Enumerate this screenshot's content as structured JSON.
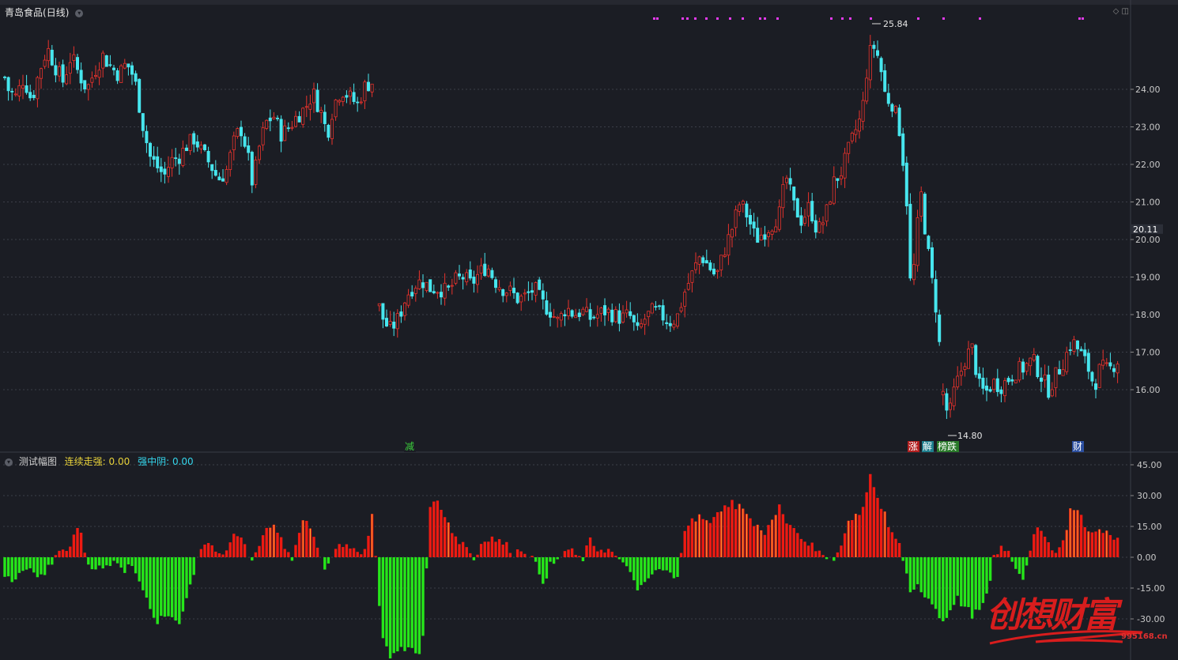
{
  "header": {
    "stock_name": "青岛食品",
    "period": "(日线)"
  },
  "indicator": {
    "name": "测试幅图",
    "field1_label": "连续走强:",
    "field1_value": "0.00",
    "field2_label": "强中阴:",
    "field2_value": "0.00"
  },
  "watermark": {
    "text": "创想财富",
    "url": "995168.cn"
  },
  "colors": {
    "up": "#e8322c",
    "down": "#47e6ee",
    "bar_up": "#ee1a12",
    "bar_down": "#26e61a",
    "magenta": "#e43bee"
  },
  "chart_data": [
    {
      "type": "candlestick",
      "title": "青岛食品(日线)",
      "y_ticks": [
        "24.00",
        "23.00",
        "22.00",
        "21.00",
        "20.00",
        "19.00",
        "18.00",
        "17.00",
        "16.00"
      ],
      "ylim": [
        14.3,
        26.5
      ],
      "last_price": "20.11",
      "annotations": {
        "high": "25.84",
        "low": "14.80",
        "events": [
          "减",
          "涨",
          "解",
          "榜跌",
          "财"
        ]
      },
      "close_path": [
        [
          0,
          24.8
        ],
        [
          10,
          24.0
        ],
        [
          20,
          23.8
        ],
        [
          30,
          24.3
        ],
        [
          40,
          23.7
        ],
        [
          50,
          24.5
        ],
        [
          60,
          25.1
        ],
        [
          70,
          24.6
        ],
        [
          80,
          24.2
        ],
        [
          90,
          24.9
        ],
        [
          100,
          24.4
        ],
        [
          110,
          24.0
        ],
        [
          120,
          24.5
        ],
        [
          130,
          24.9
        ],
        [
          140,
          24.6
        ],
        [
          150,
          24.4
        ],
        [
          160,
          24.7
        ],
        [
          170,
          24.3
        ],
        [
          176,
          23.6
        ],
        [
          182,
          22.9
        ],
        [
          190,
          22.2
        ],
        [
          200,
          21.9
        ],
        [
          208,
          21.7
        ],
        [
          216,
          22.1
        ],
        [
          226,
          22.2
        ],
        [
          236,
          22.5
        ],
        [
          246,
          22.7
        ],
        [
          256,
          22.3
        ],
        [
          266,
          22.0
        ],
        [
          276,
          21.6
        ],
        [
          286,
          21.8
        ],
        [
          296,
          22.6
        ],
        [
          304,
          23.0
        ],
        [
          312,
          22.4
        ],
        [
          320,
          21.4
        ],
        [
          326,
          22.3
        ],
        [
          336,
          23.1
        ],
        [
          346,
          23.3
        ],
        [
          356,
          22.8
        ],
        [
          366,
          23.0
        ],
        [
          376,
          23.3
        ],
        [
          386,
          23.5
        ],
        [
          396,
          23.9
        ],
        [
          406,
          23.4
        ],
        [
          414,
          22.8
        ],
        [
          422,
          23.6
        ],
        [
          432,
          24.0
        ],
        [
          442,
          23.8
        ],
        [
          452,
          23.6
        ],
        [
          462,
          24.1
        ],
        [
          472,
          24.2
        ],
        [
          478,
          18.3
        ],
        [
          486,
          17.8
        ],
        [
          494,
          17.6
        ],
        [
          504,
          17.9
        ],
        [
          514,
          18.5
        ],
        [
          524,
          18.8
        ],
        [
          534,
          18.9
        ],
        [
          544,
          18.7
        ],
        [
          556,
          18.7
        ],
        [
          566,
          18.6
        ],
        [
          576,
          18.9
        ],
        [
          586,
          19.0
        ],
        [
          596,
          18.8
        ],
        [
          606,
          19.1
        ],
        [
          616,
          19.3
        ],
        [
          626,
          18.9
        ],
        [
          636,
          18.7
        ],
        [
          646,
          18.6
        ],
        [
          656,
          18.4
        ],
        [
          666,
          18.5
        ],
        [
          676,
          18.7
        ],
        [
          686,
          18.3
        ],
        [
          696,
          18.1
        ],
        [
          706,
          17.8
        ],
        [
          716,
          18.2
        ],
        [
          726,
          18.0
        ],
        [
          736,
          18.1
        ],
        [
          746,
          17.9
        ],
        [
          756,
          18.0
        ],
        [
          766,
          18.1
        ],
        [
          776,
          18.0
        ],
        [
          786,
          17.9
        ],
        [
          796,
          18.0
        ],
        [
          806,
          17.5
        ],
        [
          816,
          17.9
        ],
        [
          826,
          18.1
        ],
        [
          836,
          18.0
        ],
        [
          846,
          17.8
        ],
        [
          856,
          17.9
        ],
        [
          866,
          18.6
        ],
        [
          876,
          19.1
        ],
        [
          886,
          19.6
        ],
        [
          896,
          19.3
        ],
        [
          906,
          19.0
        ],
        [
          916,
          19.7
        ],
        [
          926,
          20.3
        ],
        [
          936,
          21.0
        ],
        [
          946,
          20.6
        ],
        [
          956,
          20.0
        ],
        [
          966,
          20.2
        ],
        [
          976,
          20.4
        ],
        [
          986,
          20.7
        ],
        [
          994,
          21.7
        ],
        [
          1004,
          20.9
        ],
        [
          1014,
          20.5
        ],
        [
          1024,
          20.9
        ],
        [
          1034,
          20.2
        ],
        [
          1044,
          20.6
        ],
        [
          1054,
          21.5
        ],
        [
          1064,
          21.8
        ],
        [
          1072,
          22.3
        ],
        [
          1082,
          22.9
        ],
        [
          1090,
          23.3
        ],
        [
          1098,
          24.8
        ],
        [
          1104,
          25.2
        ],
        [
          1112,
          24.8
        ],
        [
          1120,
          23.8
        ],
        [
          1130,
          23.6
        ],
        [
          1138,
          22.9
        ],
        [
          1146,
          21.4
        ],
        [
          1152,
          18.6
        ],
        [
          1158,
          19.6
        ],
        [
          1164,
          21.4
        ],
        [
          1170,
          20.3
        ],
        [
          1178,
          19.0
        ],
        [
          1186,
          17.9
        ],
        [
          1192,
          16.0
        ],
        [
          1200,
          15.2
        ],
        [
          1206,
          15.9
        ],
        [
          1214,
          16.4
        ],
        [
          1222,
          16.9
        ],
        [
          1230,
          17.1
        ],
        [
          1238,
          16.1
        ],
        [
          1246,
          15.9
        ],
        [
          1256,
          16.2
        ],
        [
          1266,
          16.1
        ],
        [
          1276,
          16.3
        ],
        [
          1286,
          16.5
        ],
        [
          1296,
          16.6
        ],
        [
          1306,
          16.8
        ],
        [
          1316,
          16.4
        ],
        [
          1326,
          16.0
        ],
        [
          1336,
          16.4
        ],
        [
          1346,
          16.8
        ],
        [
          1356,
          17.3
        ],
        [
          1366,
          17.0
        ],
        [
          1376,
          16.6
        ],
        [
          1384,
          16.1
        ],
        [
          1392,
          16.6
        ],
        [
          1402,
          16.5
        ],
        [
          1414,
          16.8
        ]
      ]
    },
    {
      "type": "bar",
      "title": "测试幅图",
      "y_ticks": [
        "45.00",
        "30.00",
        "15.00",
        "0.00",
        "-15.00",
        "-30.00"
      ],
      "ylim": [
        -50,
        45
      ],
      "value_path": [
        [
          0,
          -8
        ],
        [
          10,
          -10
        ],
        [
          16,
          -12
        ],
        [
          26,
          -6
        ],
        [
          36,
          -4
        ],
        [
          46,
          -10
        ],
        [
          56,
          -8
        ],
        [
          66,
          -2
        ],
        [
          72,
          3
        ],
        [
          80,
          4
        ],
        [
          88,
          3
        ],
        [
          96,
          12
        ],
        [
          102,
          15
        ],
        [
          108,
          -2
        ],
        [
          118,
          -6
        ],
        [
          128,
          -4
        ],
        [
          138,
          -3
        ],
        [
          148,
          -2
        ],
        [
          158,
          -8
        ],
        [
          166,
          -2
        ],
        [
          176,
          -10
        ],
        [
          186,
          -22
        ],
        [
          196,
          -32
        ],
        [
          206,
          -30
        ],
        [
          216,
          -28
        ],
        [
          226,
          -32
        ],
        [
          236,
          -20
        ],
        [
          246,
          -6
        ],
        [
          252,
          4
        ],
        [
          262,
          8
        ],
        [
          272,
          4
        ],
        [
          280,
          -2
        ],
        [
          290,
          6
        ],
        [
          298,
          12
        ],
        [
          308,
          8
        ],
        [
          318,
          -2
        ],
        [
          328,
          6
        ],
        [
          338,
          16
        ],
        [
          348,
          14
        ],
        [
          358,
          6
        ],
        [
          368,
          -2
        ],
        [
          378,
          10
        ],
        [
          386,
          20
        ],
        [
          394,
          12
        ],
        [
          402,
          6
        ],
        [
          410,
          -6
        ],
        [
          420,
          2
        ],
        [
          430,
          8
        ],
        [
          440,
          4
        ],
        [
          450,
          2
        ],
        [
          460,
          4
        ],
        [
          466,
          10
        ],
        [
          472,
          24
        ],
        [
          478,
          -20
        ],
        [
          486,
          -42
        ],
        [
          494,
          -48
        ],
        [
          504,
          -46
        ],
        [
          514,
          -44
        ],
        [
          524,
          -45
        ],
        [
          534,
          -46
        ],
        [
          544,
          24
        ],
        [
          554,
          28
        ],
        [
          562,
          22
        ],
        [
          570,
          14
        ],
        [
          580,
          8
        ],
        [
          590,
          6
        ],
        [
          600,
          -2
        ],
        [
          610,
          8
        ],
        [
          620,
          10
        ],
        [
          630,
          8
        ],
        [
          640,
          6
        ],
        [
          650,
          2
        ],
        [
          660,
          4
        ],
        [
          670,
          2
        ],
        [
          680,
          -6
        ],
        [
          688,
          -12
        ],
        [
          696,
          -4
        ],
        [
          706,
          -2
        ],
        [
          716,
          4
        ],
        [
          726,
          2
        ],
        [
          736,
          -2
        ],
        [
          746,
          8
        ],
        [
          756,
          4
        ],
        [
          766,
          4
        ],
        [
          776,
          2
        ],
        [
          786,
          -4
        ],
        [
          796,
          -4
        ],
        [
          806,
          -18
        ],
        [
          816,
          -12
        ],
        [
          826,
          -8
        ],
        [
          836,
          -6
        ],
        [
          846,
          -8
        ],
        [
          856,
          -10
        ],
        [
          866,
          14
        ],
        [
          876,
          18
        ],
        [
          886,
          20
        ],
        [
          896,
          16
        ],
        [
          906,
          22
        ],
        [
          916,
          24
        ],
        [
          926,
          26
        ],
        [
          936,
          24
        ],
        [
          946,
          20
        ],
        [
          956,
          16
        ],
        [
          966,
          12
        ],
        [
          976,
          16
        ],
        [
          986,
          26
        ],
        [
          996,
          16
        ],
        [
          1006,
          12
        ],
        [
          1016,
          10
        ],
        [
          1026,
          6
        ],
        [
          1036,
          4
        ],
        [
          1046,
          -2
        ],
        [
          1056,
          -2
        ],
        [
          1066,
          10
        ],
        [
          1076,
          18
        ],
        [
          1084,
          20
        ],
        [
          1092,
          24
        ],
        [
          1100,
          40
        ],
        [
          1108,
          30
        ],
        [
          1116,
          24
        ],
        [
          1124,
          16
        ],
        [
          1132,
          10
        ],
        [
          1140,
          4
        ],
        [
          1146,
          -8
        ],
        [
          1152,
          -20
        ],
        [
          1160,
          -14
        ],
        [
          1170,
          -18
        ],
        [
          1180,
          -22
        ],
        [
          1190,
          -30
        ],
        [
          1200,
          -28
        ],
        [
          1210,
          -20
        ],
        [
          1220,
          -24
        ],
        [
          1230,
          -28
        ],
        [
          1240,
          -26
        ],
        [
          1250,
          -18
        ],
        [
          1258,
          2
        ],
        [
          1266,
          4
        ],
        [
          1276,
          2
        ],
        [
          1286,
          -6
        ],
        [
          1296,
          -10
        ],
        [
          1306,
          10
        ],
        [
          1316,
          14
        ],
        [
          1326,
          6
        ],
        [
          1336,
          4
        ],
        [
          1346,
          8
        ],
        [
          1356,
          26
        ],
        [
          1366,
          20
        ],
        [
          1376,
          14
        ],
        [
          1386,
          12
        ],
        [
          1396,
          12
        ],
        [
          1406,
          10
        ],
        [
          1416,
          8
        ]
      ]
    }
  ]
}
